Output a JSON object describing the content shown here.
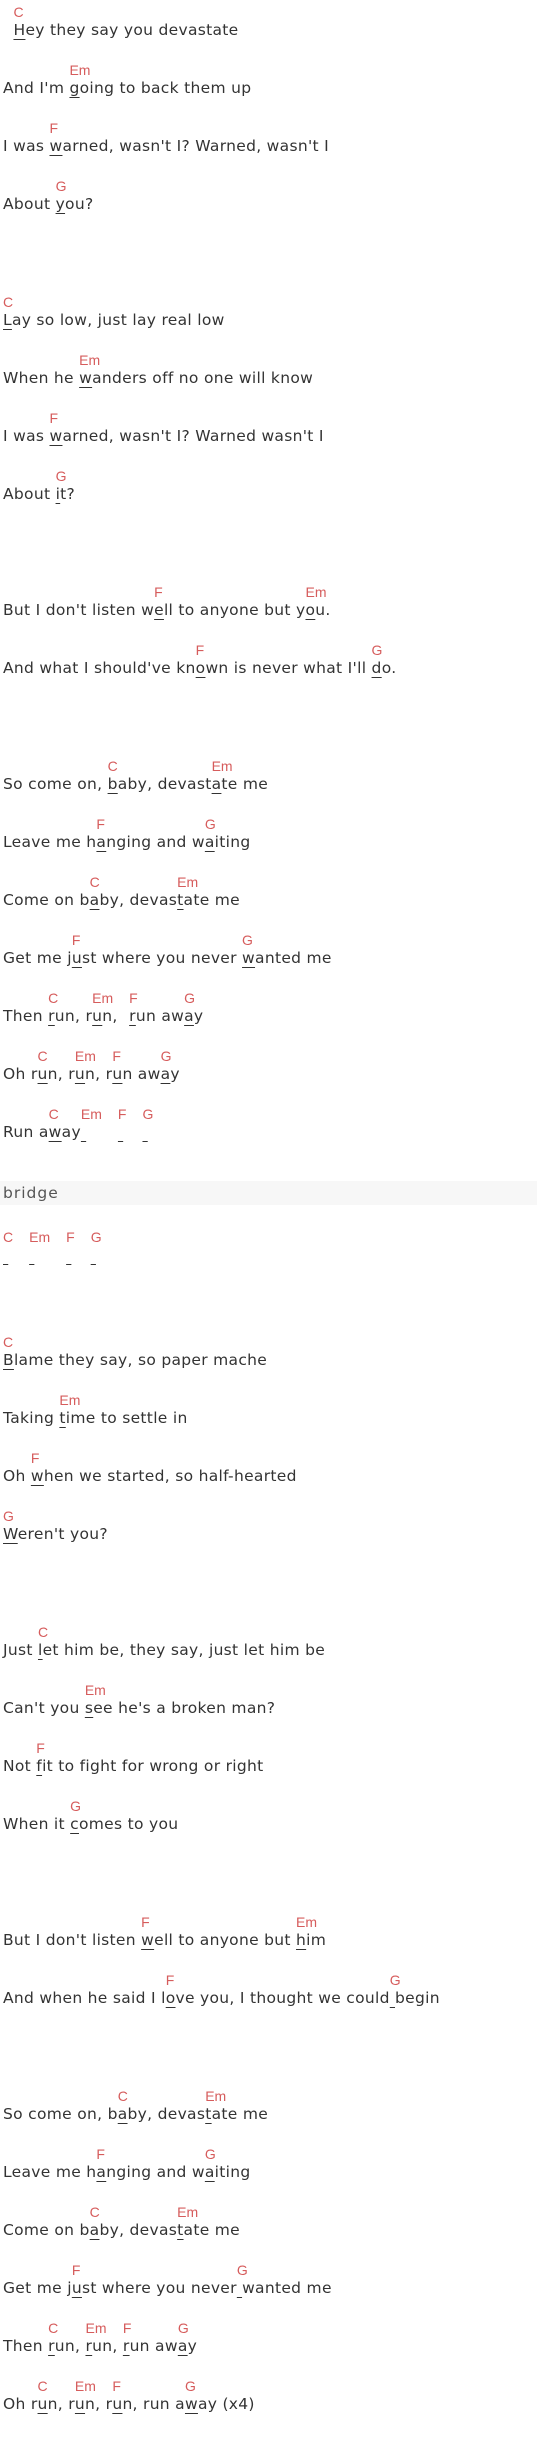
{
  "colors": {
    "chord": "#d65c5c",
    "lyric": "#333333",
    "label_bg": "#f7f7f7"
  },
  "sections": [
    {
      "lines": [
        {
          "pre": "  ",
          "segs": [
            {
              "c": "C",
              "u": "H",
              "t": "ey they say you devastate"
            }
          ]
        },
        {
          "pre": "And I'm ",
          "segs": [
            {
              "c": "Em",
              "u": "g",
              "t": "oing to back them up"
            }
          ]
        },
        {
          "pre": "I was ",
          "segs": [
            {
              "c": "F",
              "u": "w",
              "t": "arned, wasn't I? Warned, wasn't I"
            }
          ]
        },
        {
          "pre": "About ",
          "segs": [
            {
              "c": "G",
              "u": "y",
              "t": "ou?"
            }
          ]
        }
      ]
    },
    {
      "lines": [
        {
          "pre": "",
          "segs": [
            {
              "c": "C",
              "u": "L",
              "t": "ay so low, just lay real low"
            }
          ]
        },
        {
          "pre": "When he ",
          "segs": [
            {
              "c": "Em",
              "u": "w",
              "t": "anders off no one will know"
            }
          ]
        },
        {
          "pre": "I was ",
          "segs": [
            {
              "c": "F",
              "u": "w",
              "t": "arned, wasn't I? Warned wasn't I"
            }
          ]
        },
        {
          "pre": "About ",
          "segs": [
            {
              "c": "G",
              "u": "i",
              "t": "t?"
            }
          ]
        }
      ]
    },
    {
      "lines": [
        {
          "pre": "But I don't listen w",
          "segs": [
            {
              "c": "F",
              "u": "e",
              "t": "ll to anyone but y"
            },
            {
              "c": "Em",
              "u": "o",
              "t": "u."
            }
          ]
        },
        {
          "pre": "And what I should've kn",
          "segs": [
            {
              "c": "F",
              "u": "o",
              "t": "wn is never what I'll "
            },
            {
              "c": "G",
              "u": "d",
              "t": "o."
            }
          ]
        }
      ]
    },
    {
      "lines": [
        {
          "pre": "So come on, ",
          "segs": [
            {
              "c": "C",
              "u": "b",
              "t": "aby, devast"
            },
            {
              "c": "Em",
              "u": "a",
              "t": "te me"
            }
          ]
        },
        {
          "pre": "Leave me h",
          "segs": [
            {
              "c": "F",
              "u": "a",
              "t": "nging and w"
            },
            {
              "c": "G",
              "u": "a",
              "t": "iting"
            }
          ]
        },
        {
          "pre": "Come on b",
          "segs": [
            {
              "c": "C",
              "u": "a",
              "t": "by, devas"
            },
            {
              "c": "Em",
              "u": "t",
              "t": "ate me"
            }
          ]
        },
        {
          "pre": "Get me j",
          "segs": [
            {
              "c": "F",
              "u": "u",
              "t": "st where you never "
            },
            {
              "c": "G",
              "u": "w",
              "t": "anted me"
            }
          ]
        },
        {
          "pre": "Then ",
          "segs": [
            {
              "c": "C",
              "u": "r",
              "t": "un, r"
            },
            {
              "c": "Em",
              "u": "u",
              "t": "n, "
            },
            {
              "c": "F",
              "u": "r",
              "t": "un aw"
            },
            {
              "c": "G",
              "u": "a",
              "t": "y"
            }
          ]
        },
        {
          "pre": "Oh r",
          "segs": [
            {
              "c": "C",
              "u": "u",
              "t": "n, r"
            },
            {
              "c": "Em",
              "u": "u",
              "t": "n, r"
            },
            {
              "c": "F",
              "u": "u",
              "t": "n aw"
            },
            {
              "c": "G",
              "u": "a",
              "t": "y"
            }
          ]
        },
        {
          "pre": "Run a",
          "segs": [
            {
              "c": "C",
              "u": "w",
              "t": "ay"
            },
            {
              "c": "Em",
              "u": " ",
              "t": ""
            },
            {
              "c": "F",
              "u": " ",
              "t": ""
            },
            {
              "c": "G",
              "u": " ",
              "t": ""
            }
          ]
        }
      ]
    },
    {
      "label": "bridge",
      "lines": [
        {
          "pre": "",
          "segs": [
            {
              "c": "C",
              "u": " ",
              "t": ""
            },
            {
              "c": "Em",
              "u": " ",
              "t": ""
            },
            {
              "c": "F",
              "u": " ",
              "t": ""
            },
            {
              "c": "G",
              "u": " ",
              "t": ""
            }
          ]
        }
      ]
    },
    {
      "lines": [
        {
          "pre": "",
          "segs": [
            {
              "c": "C",
              "u": "B",
              "t": "lame they say, so paper mache"
            }
          ]
        },
        {
          "pre": "Taking ",
          "segs": [
            {
              "c": "Em",
              "u": "t",
              "t": "ime to settle in"
            }
          ]
        },
        {
          "pre": "Oh ",
          "segs": [
            {
              "c": "F",
              "u": "w",
              "t": "hen we started, so half-hearted"
            }
          ]
        },
        {
          "pre": "",
          "segs": [
            {
              "c": "G",
              "u": "W",
              "t": "eren't you?"
            }
          ]
        }
      ]
    },
    {
      "lines": [
        {
          "pre": "Just ",
          "segs": [
            {
              "c": "C",
              "u": "l",
              "t": "et him be, they say, just let him be"
            }
          ]
        },
        {
          "pre": "Can't you ",
          "segs": [
            {
              "c": "Em",
              "u": "s",
              "t": "ee he's a broken man?"
            }
          ]
        },
        {
          "pre": "Not ",
          "segs": [
            {
              "c": "F",
              "u": "f",
              "t": "it to fight for wrong or right"
            }
          ]
        },
        {
          "pre": "When it ",
          "segs": [
            {
              "c": "G",
              "u": "c",
              "t": "omes to you"
            }
          ]
        }
      ]
    },
    {
      "lines": [
        {
          "pre": "But I don't listen ",
          "segs": [
            {
              "c": "F",
              "u": "w",
              "t": "ell to anyone but "
            },
            {
              "c": "Em",
              "u": "h",
              "t": "im"
            }
          ]
        },
        {
          "pre": "And when he said I l",
          "segs": [
            {
              "c": "F",
              "u": "o",
              "t": "ve you, I thought we could"
            },
            {
              "c": "G",
              "u": " ",
              "t": "begin"
            }
          ]
        }
      ]
    },
    {
      "lines": [
        {
          "pre": "So come on, b",
          "segs": [
            {
              "c": "C",
              "u": "a",
              "t": "by, devas"
            },
            {
              "c": "Em",
              "u": "t",
              "t": "ate me"
            }
          ]
        },
        {
          "pre": "Leave me h",
          "segs": [
            {
              "c": "F",
              "u": "a",
              "t": "nging and w"
            },
            {
              "c": "G",
              "u": "a",
              "t": "iting"
            }
          ]
        },
        {
          "pre": "Come on b",
          "segs": [
            {
              "c": "C",
              "u": "a",
              "t": "by, devas"
            },
            {
              "c": "Em",
              "u": "t",
              "t": "ate me"
            }
          ]
        },
        {
          "pre": "Get me j",
          "segs": [
            {
              "c": "F",
              "u": "u",
              "t": "st where you never"
            },
            {
              "c": "G",
              "u": " ",
              "t": "wanted me"
            }
          ]
        },
        {
          "pre": "Then ",
          "segs": [
            {
              "c": "C",
              "u": "r",
              "t": "un, "
            },
            {
              "c": "Em",
              "u": "r",
              "t": "un, "
            },
            {
              "c": "F",
              "u": "r",
              "t": "un aw"
            },
            {
              "c": "G",
              "u": "a",
              "t": "y"
            }
          ]
        },
        {
          "pre": "Oh r",
          "segs": [
            {
              "c": "C",
              "u": "u",
              "t": "n, r"
            },
            {
              "c": "Em",
              "u": "u",
              "t": "n, r"
            },
            {
              "c": "F",
              "u": "u",
              "t": "n, run a"
            },
            {
              "c": "G",
              "u": "w",
              "t": "ay (x4)"
            }
          ]
        }
      ]
    }
  ]
}
